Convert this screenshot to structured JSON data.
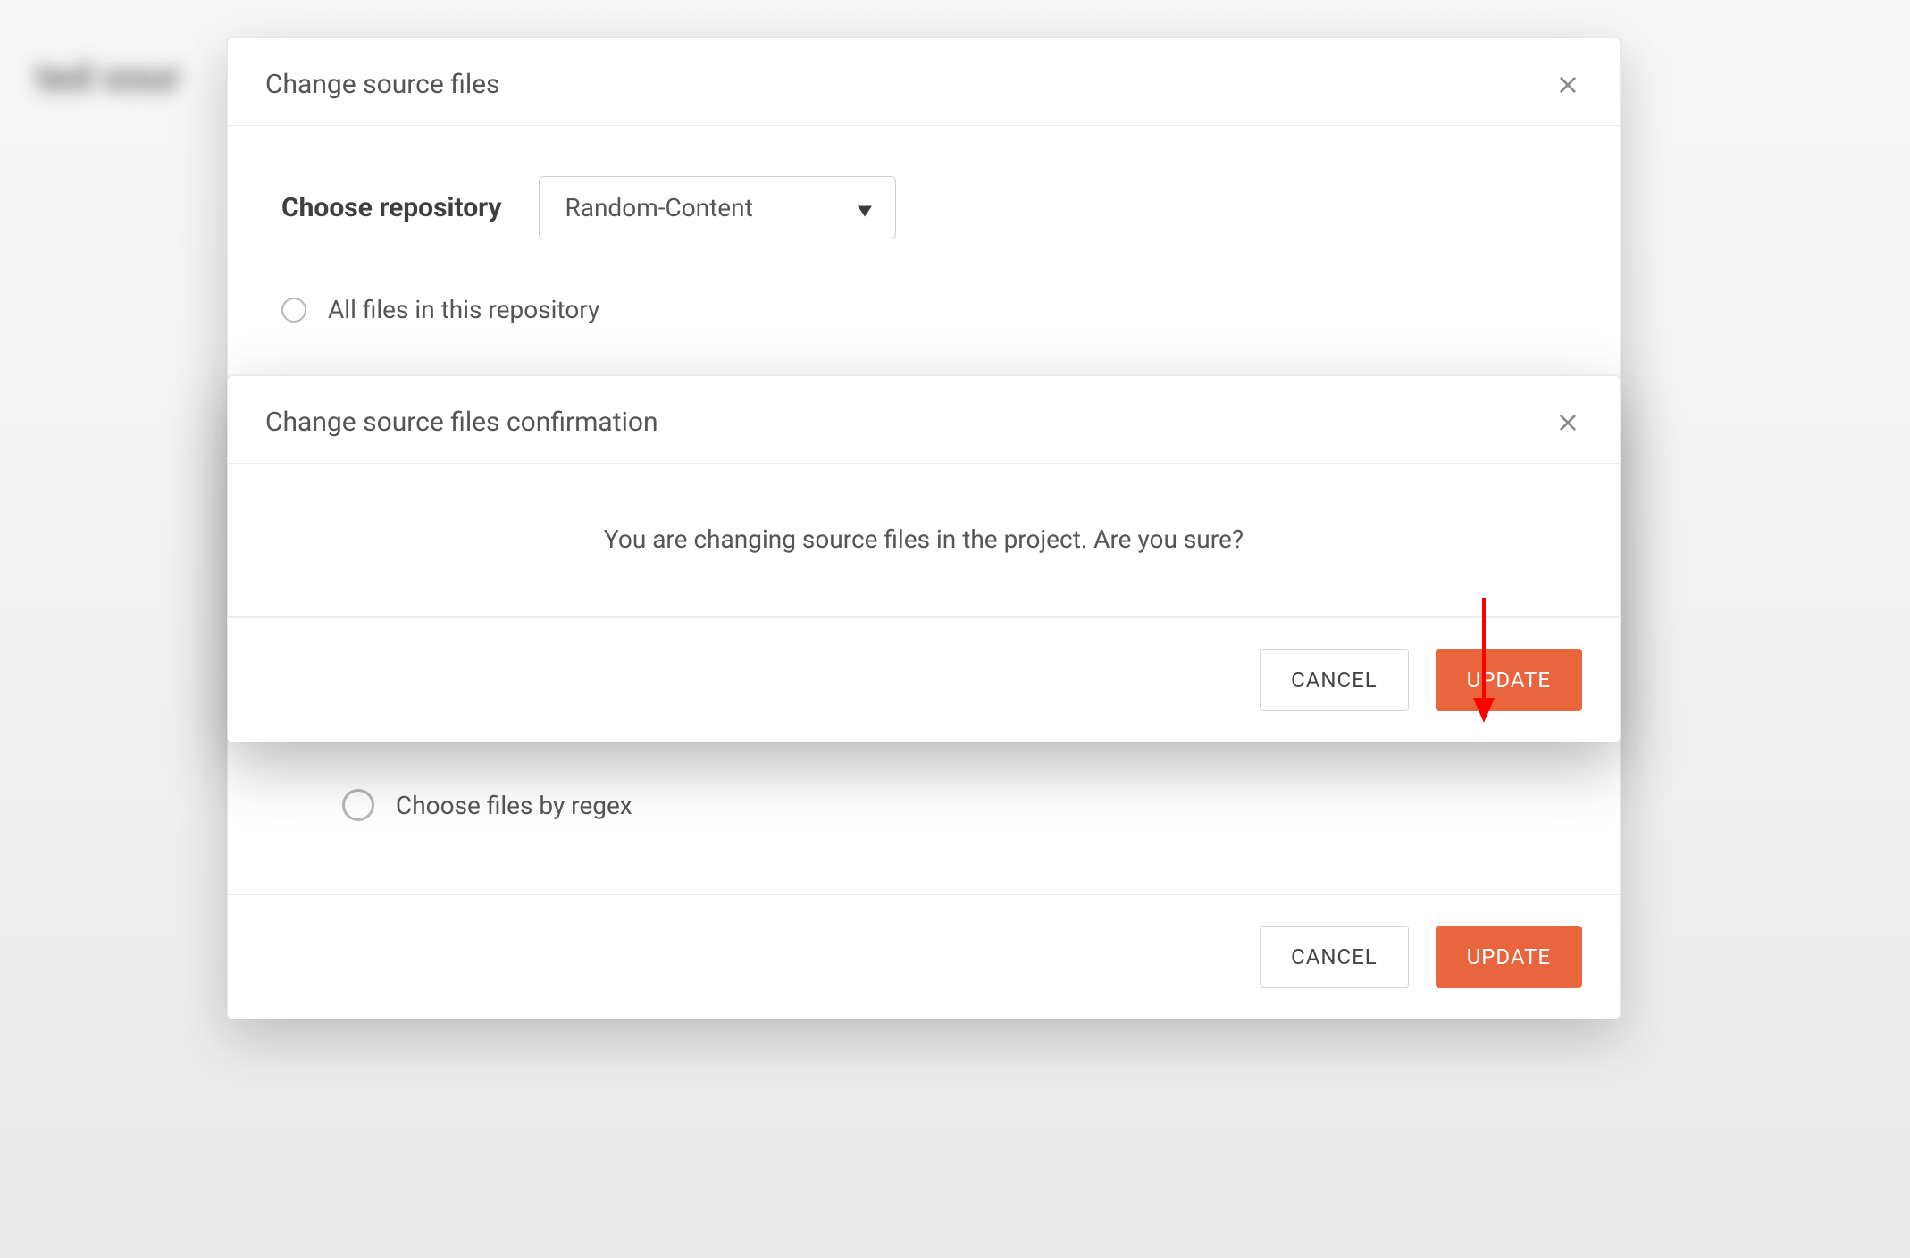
{
  "background": {
    "heading_fragment": "ted sour"
  },
  "outerModal": {
    "title": "Change source files",
    "repoLabel": "Choose repository",
    "repoSelected": "Random-Content",
    "optAllFiles": "All files in this repository",
    "optRegex": "Choose files by regex",
    "cancel": "CANCEL",
    "update": "UPDATE"
  },
  "confirmModal": {
    "title": "Change source files confirmation",
    "message": "You are changing source files in the project. Are you sure?",
    "cancel": "CANCEL",
    "update": "UPDATE"
  },
  "colors": {
    "accent": "#e9653d",
    "annotation": "#ff0000"
  }
}
